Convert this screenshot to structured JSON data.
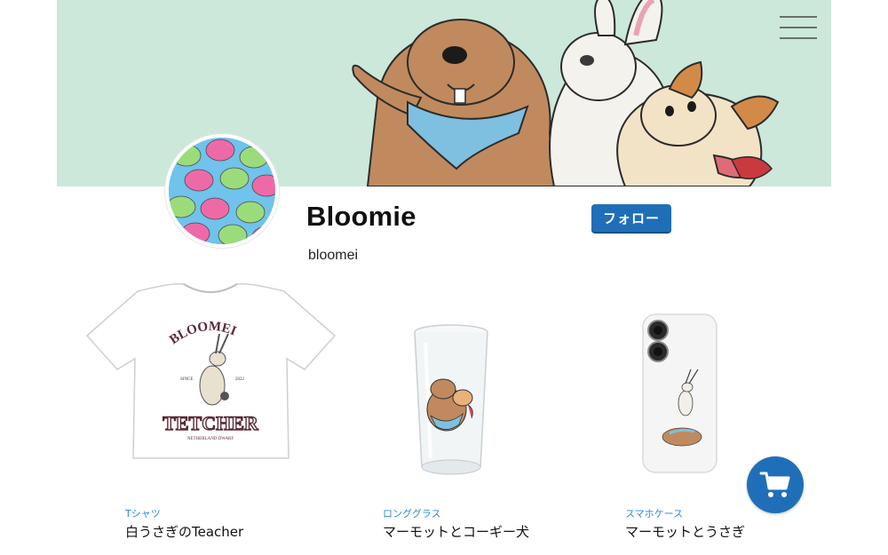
{
  "banner": {
    "background": "#cbe8da"
  },
  "profile": {
    "name": "Bloomie",
    "handle": "bloomei",
    "follow_label": "フォロー"
  },
  "products": [
    {
      "category": "Tシャツ",
      "title": "白うさぎのTeacher",
      "print": {
        "arc_text": "BLOOMEI",
        "since": "SINCE",
        "year": "2022",
        "main_text": "TETCHER",
        "sub_text": "NETHERLAND DWARF"
      }
    },
    {
      "category": "ロンググラス",
      "title": "マーモットとコーギー犬"
    },
    {
      "category": "スマホケース",
      "title": "マーモットとうさぎ"
    }
  ],
  "colors": {
    "accent": "#1f6fb8",
    "category": "#2d8bd6"
  },
  "icons": {
    "menu": "hamburger-menu-icon",
    "cart": "cart-icon"
  }
}
